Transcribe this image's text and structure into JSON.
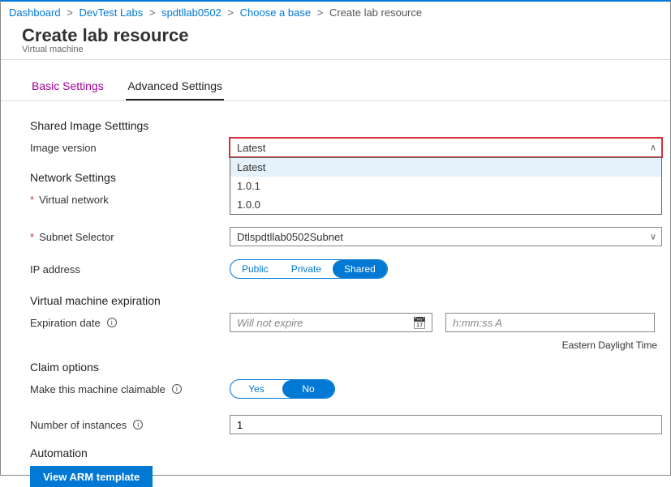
{
  "breadcrumb": {
    "items": [
      "Dashboard",
      "DevTest Labs",
      "spdtllab0502",
      "Choose a base"
    ],
    "current": "Create lab resource"
  },
  "header": {
    "title": "Create lab resource",
    "subtitle": "Virtual machine"
  },
  "tabs": {
    "basic": "Basic Settings",
    "advanced": "Advanced Settings"
  },
  "sections": {
    "sharedImage": "Shared Image Setttings",
    "network": "Network Settings",
    "vmExp": "Virtual machine expiration",
    "claim": "Claim options",
    "automation": "Automation"
  },
  "labels": {
    "imageVersion": "Image version",
    "virtualNetwork": "Virtual network",
    "subnetSelector": "Subnet Selector",
    "ipAddress": "IP address",
    "expirationDate": "Expiration date",
    "claimable": "Make this machine claimable",
    "numInstances": "Number of instances"
  },
  "imageVersion": {
    "value": "Latest",
    "options": [
      "Latest",
      "1.0.1",
      "1.0.0"
    ]
  },
  "subnet": {
    "value": "Dtlspdtllab0502Subnet"
  },
  "ip": {
    "options": [
      "Public",
      "Private",
      "Shared"
    ],
    "selected": "Shared"
  },
  "expiration": {
    "datePlaceholder": "Will not expire",
    "timePlaceholder": "h:mm:ss A",
    "tz": "Eastern Daylight Time"
  },
  "claimToggle": {
    "yes": "Yes",
    "no": "No"
  },
  "instances": {
    "value": "1"
  },
  "buttons": {
    "viewArm": "View ARM template"
  }
}
